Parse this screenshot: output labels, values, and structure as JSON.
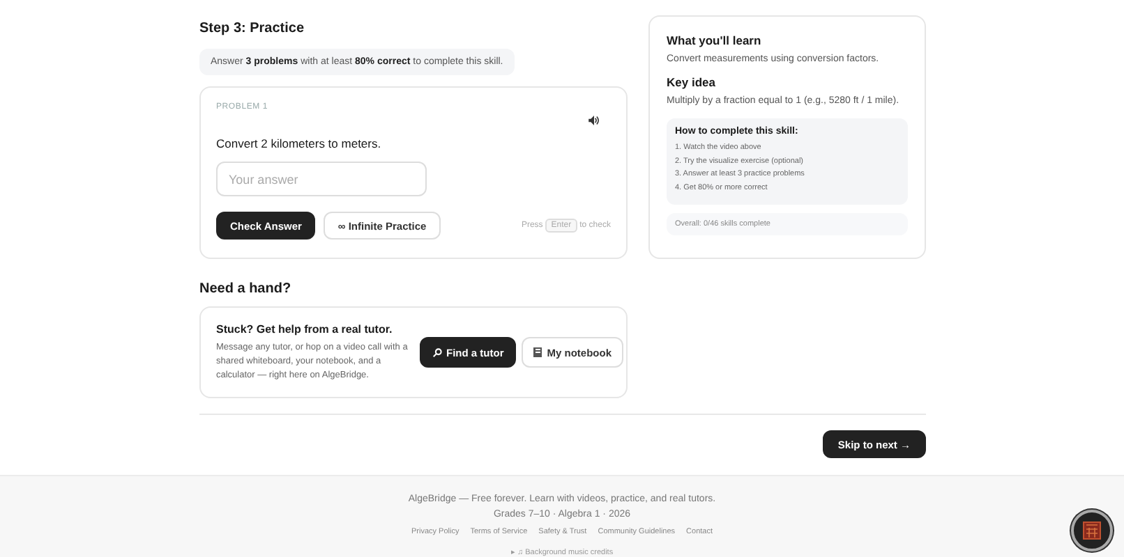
{
  "practice": {
    "heading": "Step 3: Practice",
    "requirement": "Answer **3 problems** with at least **80% correct** to complete this skill.",
    "problem": {
      "label": "PROBLEM 1",
      "question": "Convert 2 kilometers to meters.",
      "answer_placeholder": "Your answer",
      "check_button": "Check Answer",
      "infinite_button": "∞ Infinite Practice",
      "hint_before": "Press",
      "hint_key": "Enter",
      "hint_after": "to check"
    }
  },
  "help": {
    "heading": "Need a hand?",
    "title": "Stuck? Get help from a real tutor.",
    "body": "Message any tutor, or hop on a video call with a shared whiteboard, your notebook, and a calculator — right here on AlgeBridge.",
    "tutor_button": "Find a tutor",
    "notebook_button": "My notebook"
  },
  "sidebar": {
    "learn_heading": "What you'll learn",
    "learn_text": "Convert measurements using conversion factors.",
    "key_heading": "Key idea",
    "key_text": "Multiply by a fraction equal to 1 (e.g., 5280 ft / 1 mile).",
    "steps_heading": "How to complete this skill:",
    "steps": [
      "1. Watch the video above",
      "2. Try the visualize exercise (optional)",
      "3. Answer at least 3 practice problems",
      "4. Get 80% or more correct"
    ],
    "overall": "Overall: 0/46 skills complete"
  },
  "skip_button": "Skip to next →",
  "footer": {
    "tagline": "AlgeBridge — Free forever. Learn with videos, practice, and real tutors.",
    "meta": "Grades 7–10 · Algebra 1 · 2026",
    "links": [
      "Privacy Policy",
      "Terms of Service",
      "Safety & Trust",
      "Community Guidelines",
      "Contact"
    ],
    "credits": "▸ ♫ Background music credits"
  }
}
